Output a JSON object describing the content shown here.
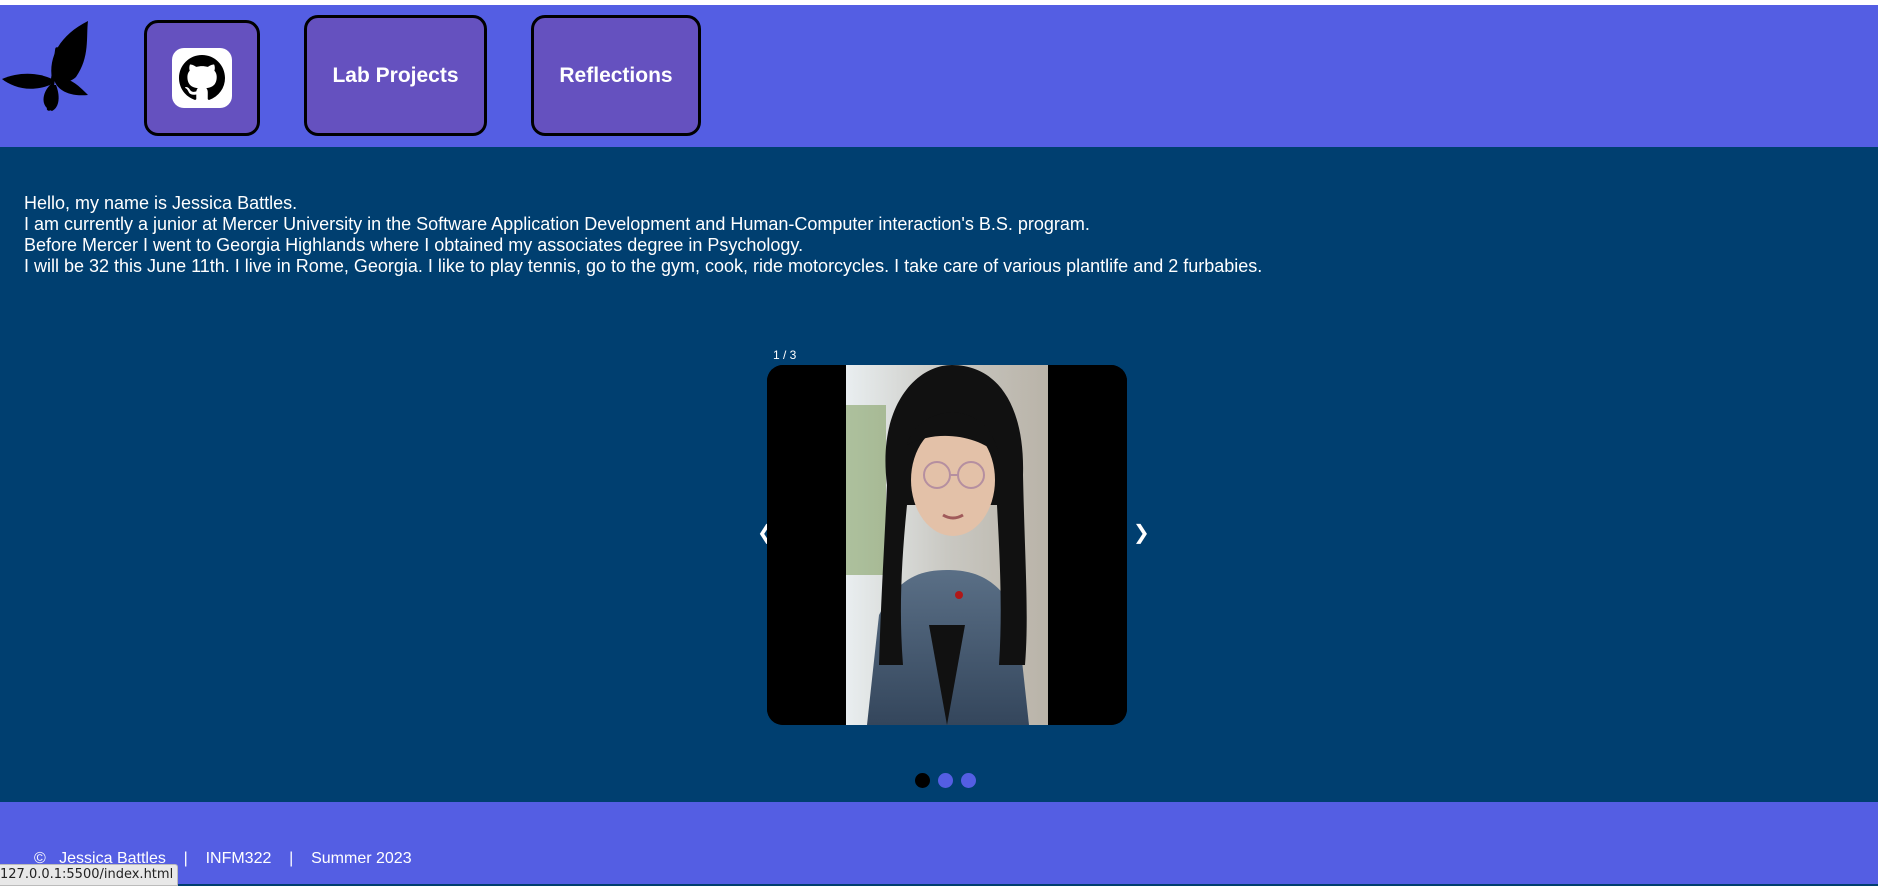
{
  "nav": {
    "lab_projects": "Lab Projects",
    "reflections": "Reflections",
    "github_icon": "github-icon",
    "logo_icon": "butterfly-icon"
  },
  "intro": {
    "lines": [
      "Hello, my name is Jessica Battles.",
      "I am currently a junior at Mercer University in the Software Application Development and Human-Computer interaction's B.S. program.",
      "Before Mercer I went to Georgia Highlands where I obtained my associates degree in Psychology.",
      "I will be 32 this June 11th. I live in Rome, Georgia. I like to play tennis, go to the gym, cook, ride motorcycles. I take care of various plantlife and 2 furbabies."
    ]
  },
  "slideshow": {
    "counter": "1 / 3",
    "prev": "❮",
    "next": "❯",
    "current": 1,
    "total": 3
  },
  "footer": {
    "copyright": "©",
    "name": "Jessica Battles",
    "sep": "|",
    "course": "INFM322",
    "term": "Summer 2023"
  },
  "status_bar": {
    "url": "127.0.0.1:5500/index.html"
  },
  "colors": {
    "header_bg": "#545ee3",
    "main_bg": "#003f70",
    "nav_button_bg": "#6551bf"
  }
}
